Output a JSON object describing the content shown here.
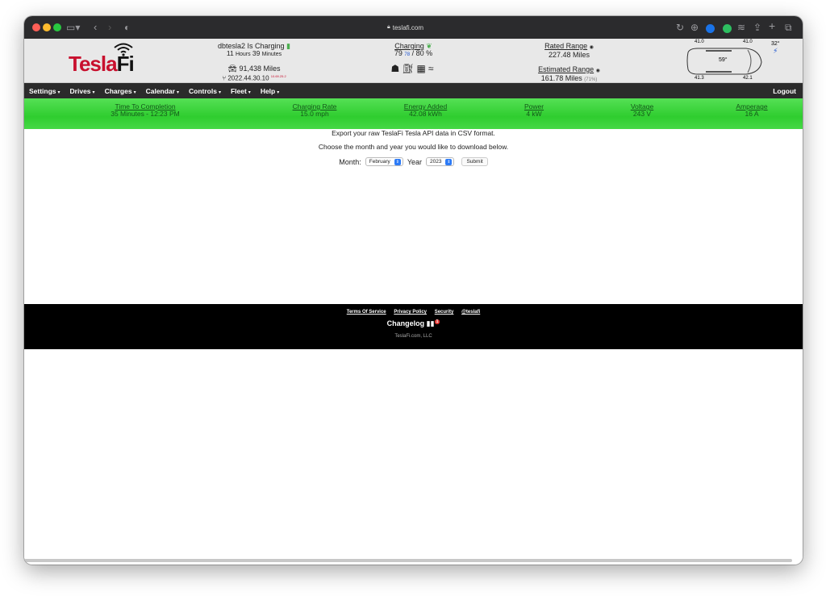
{
  "browser": {
    "url": "teslafi.com"
  },
  "header": {
    "logo": {
      "part1": "Tesla",
      "part2": "Fi"
    },
    "vehicle": {
      "status": "dbtesla2 Is Charging",
      "charge_time_hours": "11",
      "charge_time_hours_label": "Hours",
      "charge_time_minutes": "39",
      "charge_time_minutes_label": "Minutes",
      "odometer": "91,438 Miles",
      "version": "2022.44.30.10",
      "version_sup": "10.69.25.2"
    },
    "charging": {
      "label": "Charging",
      "current": "79",
      "sub": "78",
      "target": "80",
      "pct": "%"
    },
    "range": {
      "rated_label": "Rated Range",
      "rated_value": "227.48 Miles",
      "estimated_label": "Estimated Range",
      "estimated_value": "161.78 Miles",
      "estimated_pct": "(71%)"
    },
    "tires": {
      "front_left": "41.0",
      "front_right": "41.0",
      "rear_left": "41.3",
      "rear_right": "42.1",
      "interior_temp": "59°",
      "outside_temp": "32°"
    }
  },
  "nav": {
    "items": [
      "Settings",
      "Drives",
      "Charges",
      "Calendar",
      "Controls",
      "Fleet",
      "Help"
    ],
    "logout": "Logout"
  },
  "status_bar": {
    "items": [
      {
        "label": "Time To Completion",
        "value": "35 Minutes - 12:23 PM"
      },
      {
        "label": "Charging Rate",
        "value": "15.0 mph"
      },
      {
        "label": "Energy Added",
        "value": "42.08 kWh"
      },
      {
        "label": "Power",
        "value": "4 kW"
      },
      {
        "label": "Voltage",
        "value": "243 V"
      },
      {
        "label": "Amperage",
        "value": "16 A"
      }
    ]
  },
  "main": {
    "line1": "Export your raw TeslaFi Tesla API data in CSV format.",
    "line2": "Choose the month and year you would like to download below.",
    "month_label": "Month:",
    "month_value": "February",
    "year_label": "Year",
    "year_value": "2023",
    "submit": "Submit"
  },
  "footer": {
    "links": [
      "Terms Of Service",
      "Privacy Policy",
      "Security",
      "@teslafi"
    ],
    "changelog": "Changelog",
    "changelog_badge": "1",
    "copyright": "TeslaFi.com, LLC"
  },
  "colors": {
    "brand_red": "#c8102e",
    "status_green": "#2fcd2f",
    "nav_bg": "#2b2b2b",
    "accent_blue": "#2d7bf6"
  }
}
